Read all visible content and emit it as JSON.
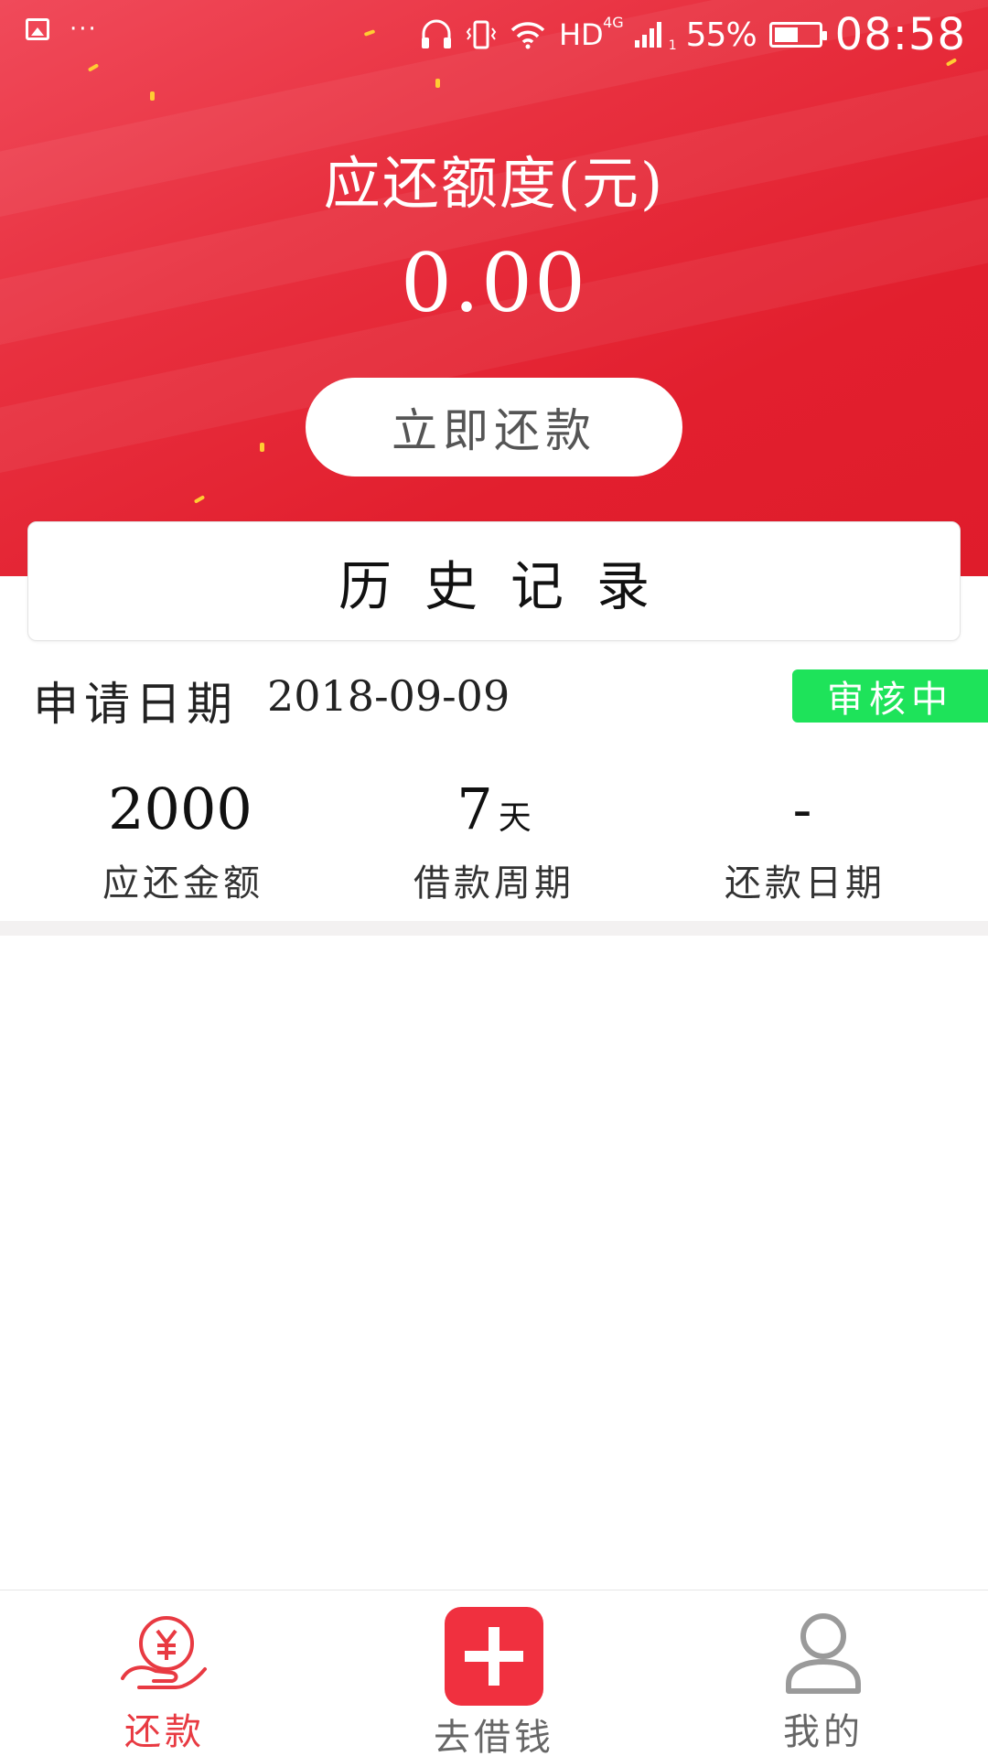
{
  "status_bar": {
    "network": "HD",
    "network_sup": "4G",
    "sim": "1",
    "battery_percent": "55%",
    "battery_level": 0.55,
    "time": "08:58",
    "more": "···"
  },
  "hero": {
    "title": "应还额度(元)",
    "amount": "0.00",
    "repay_button": "立即还款",
    "colors": {
      "primary": "#e8303f",
      "button_bg": "#ffffff"
    }
  },
  "history": {
    "label": "历史记录"
  },
  "record": {
    "apply_label": "申请日期",
    "apply_date": "2018-09-09",
    "status": "审核中",
    "status_color": "#1ee35a",
    "stats": [
      {
        "value": "2000",
        "unit": "",
        "label": "应还金额"
      },
      {
        "value": "7",
        "unit": "天",
        "label": "借款周期"
      },
      {
        "value": "-",
        "unit": "",
        "label": "还款日期"
      }
    ]
  },
  "nav": {
    "active_color": "#e83a42",
    "items": [
      {
        "label": "还款",
        "icon": "yen-hand-icon",
        "active": true
      },
      {
        "label": "去借钱",
        "icon": "plus-icon",
        "active": false
      },
      {
        "label": "我的",
        "icon": "user-icon",
        "active": false
      }
    ]
  }
}
